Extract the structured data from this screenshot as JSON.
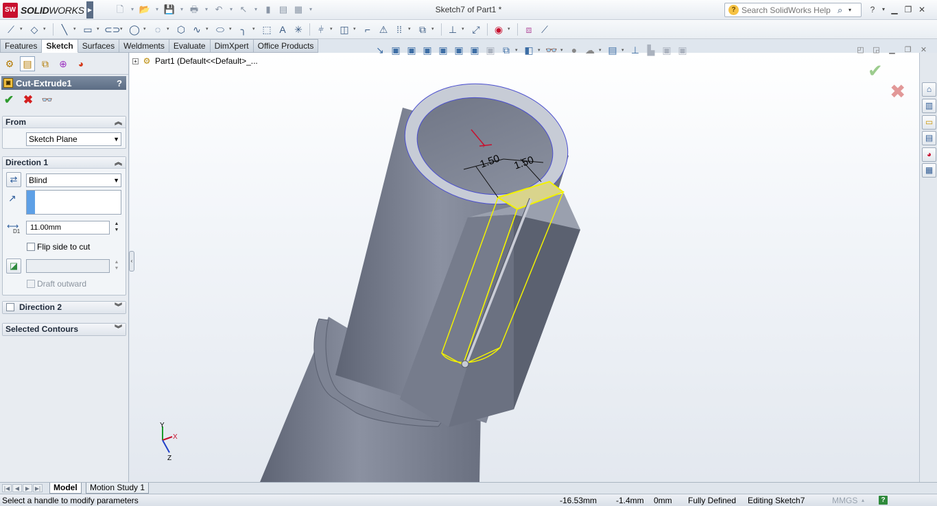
{
  "app": {
    "logo_badge": "SW",
    "logo_text_bold": "SOLID",
    "logo_text_light": "WORKS",
    "document_title": "Sketch7 of Part1 *"
  },
  "search": {
    "placeholder": "Search SolidWorks Help",
    "value": ""
  },
  "command_tabs": [
    "Features",
    "Sketch",
    "Surfaces",
    "Weldments",
    "Evaluate",
    "DimXpert",
    "Office Products"
  ],
  "command_tabs_active": "Sketch",
  "feature_tree": {
    "root_label": "Part1  (Default<<Default>_..."
  },
  "property_manager": {
    "title": "Cut-Extrude1",
    "help": "?",
    "from": {
      "header": "From",
      "selected": "Sketch Plane"
    },
    "direction1": {
      "header": "Direction 1",
      "end_condition": "Blind",
      "depth": "11.00mm",
      "depth_label": "D1",
      "flip_side_label": "Flip side to cut",
      "draft_outward_label": "Draft outward"
    },
    "direction2": {
      "header": "Direction 2"
    },
    "selected_contours": {
      "header": "Selected Contours"
    }
  },
  "model": {
    "dimension_1": "1.50",
    "dimension_2": "1.50",
    "triad_x": "X",
    "triad_y": "Y",
    "triad_z": "Z"
  },
  "bottom_tabs": [
    "Model",
    "Motion Study 1"
  ],
  "bottom_tabs_active": "Model",
  "status": {
    "message": "Select a handle to modify parameters",
    "x": "-16.53mm",
    "y": "-1.4mm",
    "z": "0mm",
    "sketch_state": "Fully Defined",
    "editing": "Editing Sketch7",
    "units": "MMGS",
    "help": "?"
  },
  "colors": {
    "model_body": "#7a8090",
    "sketch_highlight": "#f2f200",
    "accept_green": "#2e9a2e",
    "cancel_red": "#d42020",
    "pm_header": "#5c6d84"
  }
}
